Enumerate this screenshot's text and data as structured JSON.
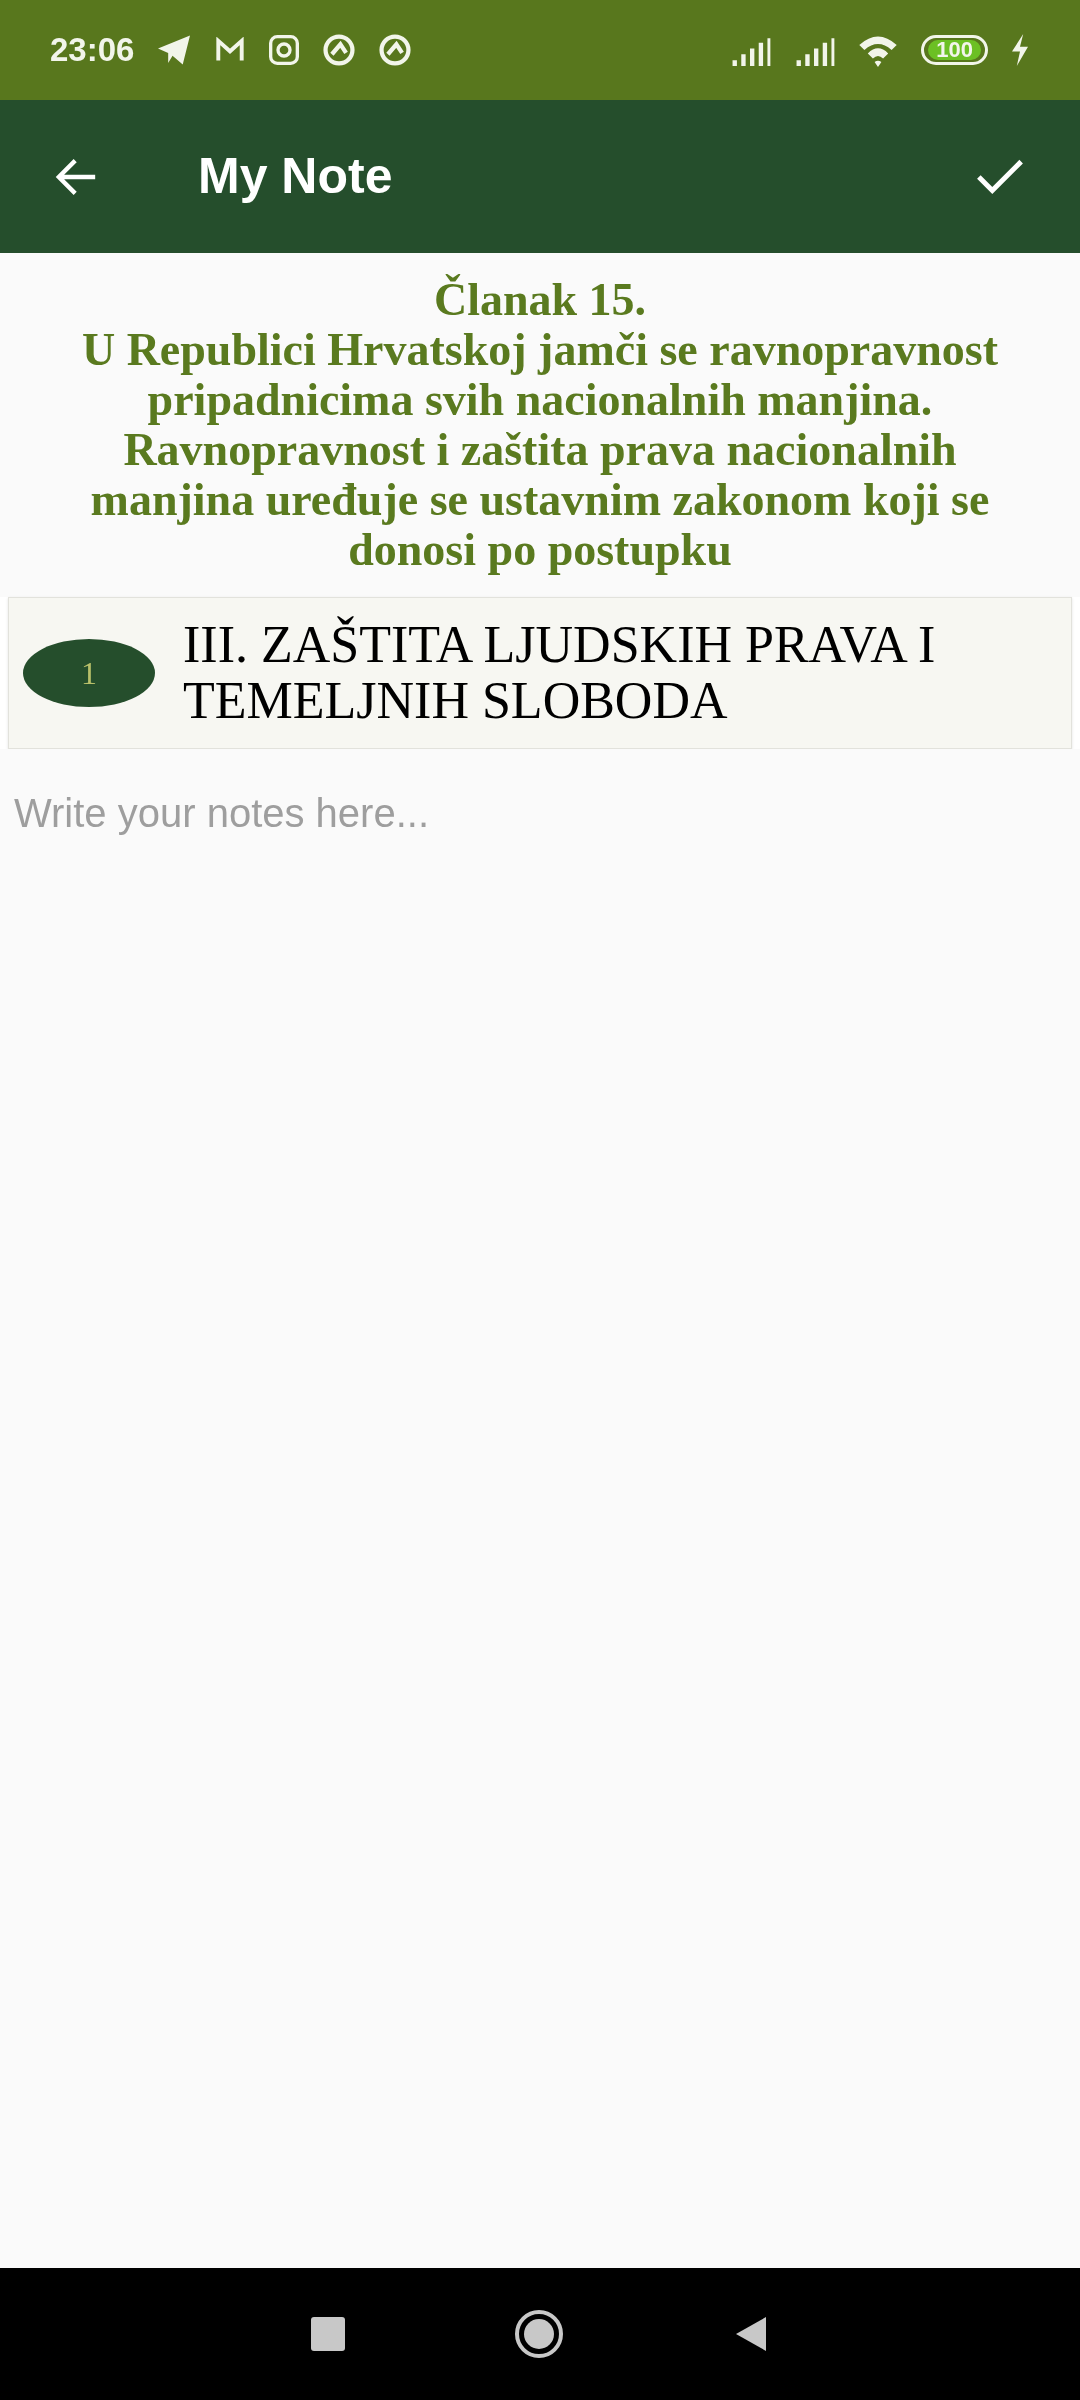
{
  "status_bar": {
    "time": "23:06",
    "battery": "100"
  },
  "app_bar": {
    "title": "My Note"
  },
  "article": {
    "title": "Članak 15.",
    "text": "U Republici Hrvatskoj jamči se ravnopravnost pripadnicima svih nacionalnih manjina. Ravnopravnost i zaštita prava nacionalnih manjina uređuje se ustavnim zakonom koji se donosi po postupku"
  },
  "section": {
    "number": "1",
    "title": "III. ZAŠTITA LJUDSKIH PRAVA I TEMELJNIH SLOBODA"
  },
  "note": {
    "placeholder": "Write your notes here..."
  }
}
